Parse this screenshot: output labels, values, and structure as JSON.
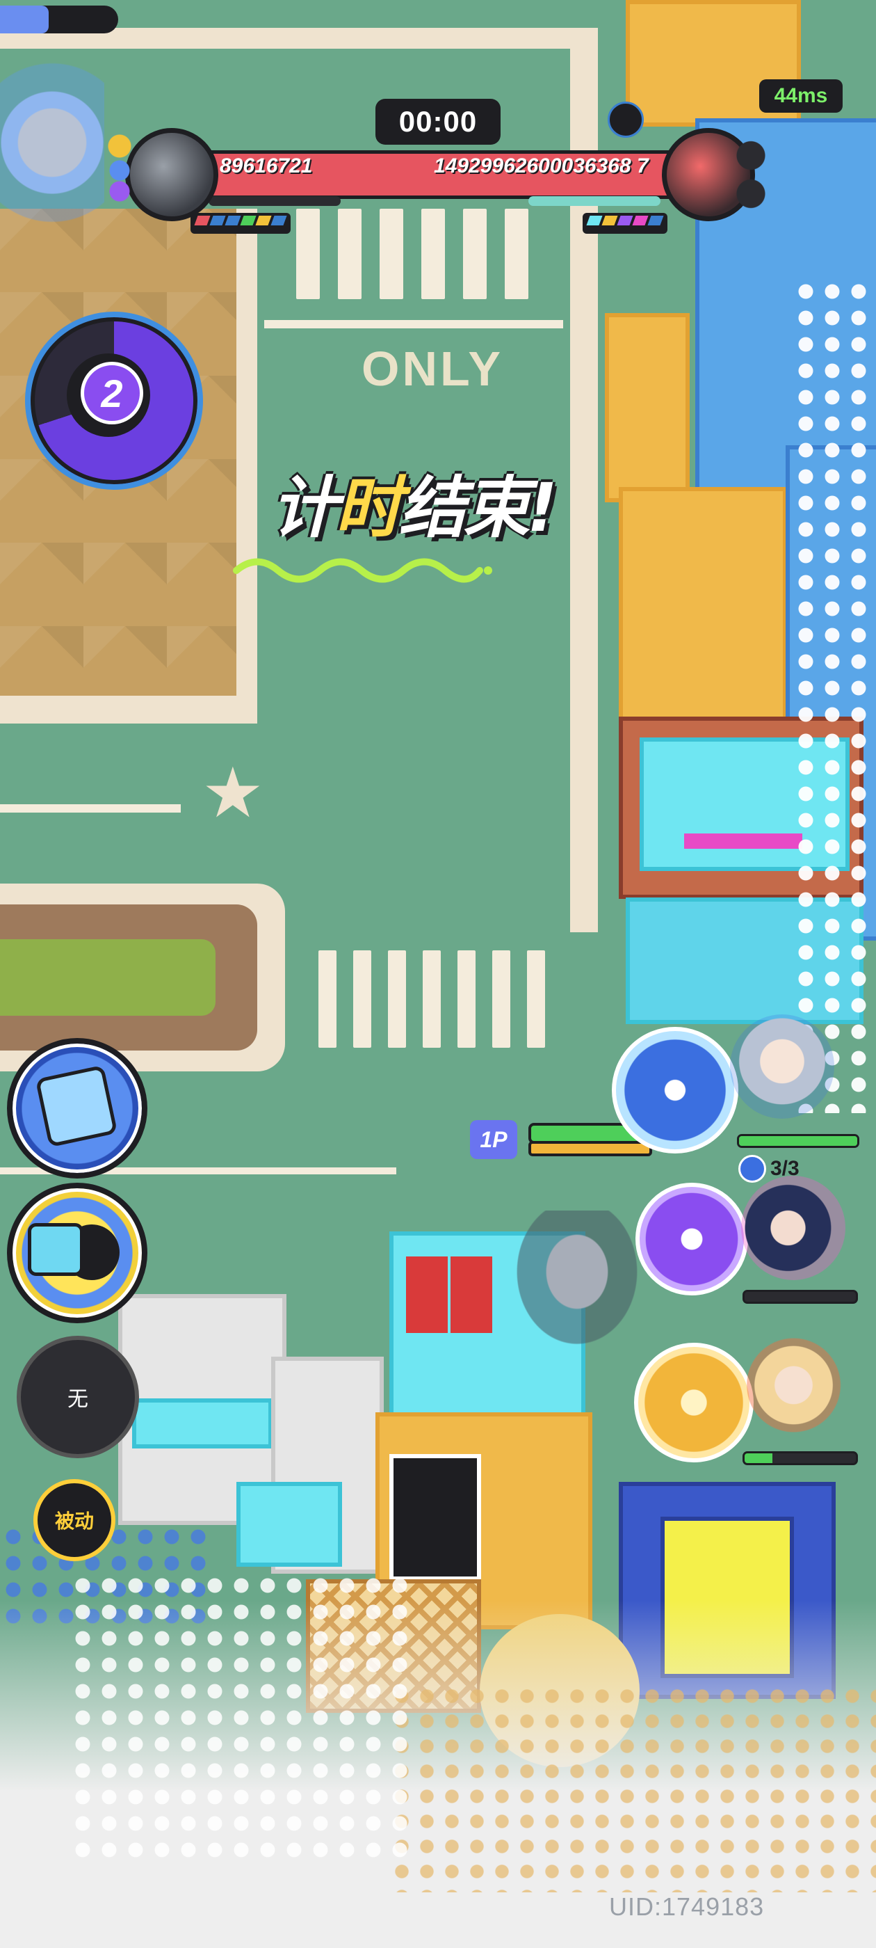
{
  "hud": {
    "timer": "00:00",
    "ping": "44ms",
    "left_score": "89616721",
    "right_score": "14929962600036368 7",
    "kill_count": "2"
  },
  "banner": {
    "part1": "计",
    "part2": "时",
    "part3": "结束!"
  },
  "map": {
    "road_text": "ONLY"
  },
  "skills": {
    "slot3_label": "无",
    "passive_label": "被动"
  },
  "player": {
    "tag": "1P",
    "ammo": "3/3"
  },
  "footer": {
    "uid": "UID:1749183"
  },
  "colors": {
    "enemy_bar": "#e65560",
    "hp_green": "#4ecf5a",
    "energy_orange": "#f2b53a",
    "ping_green": "#7df06a",
    "accent_yellow": "#ffd94a",
    "player_tag": "#6a74f0"
  }
}
